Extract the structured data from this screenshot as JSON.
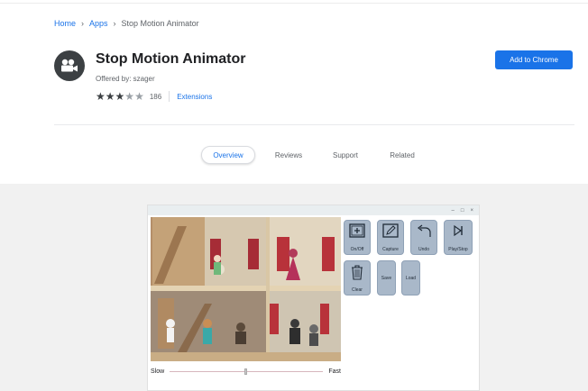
{
  "breadcrumb": {
    "home": "Home",
    "apps": "Apps",
    "current": "Stop Motion Animator",
    "sep": "›"
  },
  "app": {
    "title": "Stop Motion Animator",
    "offered_by": "Offered by: szager",
    "rating_stars": 3,
    "rating_count": "186",
    "category": "Extensions",
    "icon": "film-camera-icon"
  },
  "actions": {
    "add_label": "Add to Chrome"
  },
  "tabs": [
    {
      "label": "Overview",
      "active": true
    },
    {
      "label": "Reviews",
      "active": false
    },
    {
      "label": "Support",
      "active": false
    },
    {
      "label": "Related",
      "active": false
    }
  ],
  "screenshot": {
    "window_controls": {
      "minimize": "–",
      "maximize": "□",
      "close": "×"
    },
    "tools": [
      {
        "label": "On/Off",
        "icon": "plus-box-icon"
      },
      {
        "label": "Capture",
        "icon": "pencil-icon"
      },
      {
        "label": "Undo",
        "icon": "undo-arrow-icon"
      },
      {
        "label": "Play/Stop",
        "icon": "play-stop-icon"
      },
      {
        "label": "Clear",
        "icon": "trash-icon"
      },
      {
        "label": "Save",
        "icon": "save-icon"
      },
      {
        "label": "Load",
        "icon": "load-icon"
      }
    ],
    "speed": {
      "slow": "Slow",
      "fast": "Fast",
      "value": 0.5
    }
  },
  "colors": {
    "accent": "#1a73e8",
    "tool_bg": "#a9b8c9"
  }
}
